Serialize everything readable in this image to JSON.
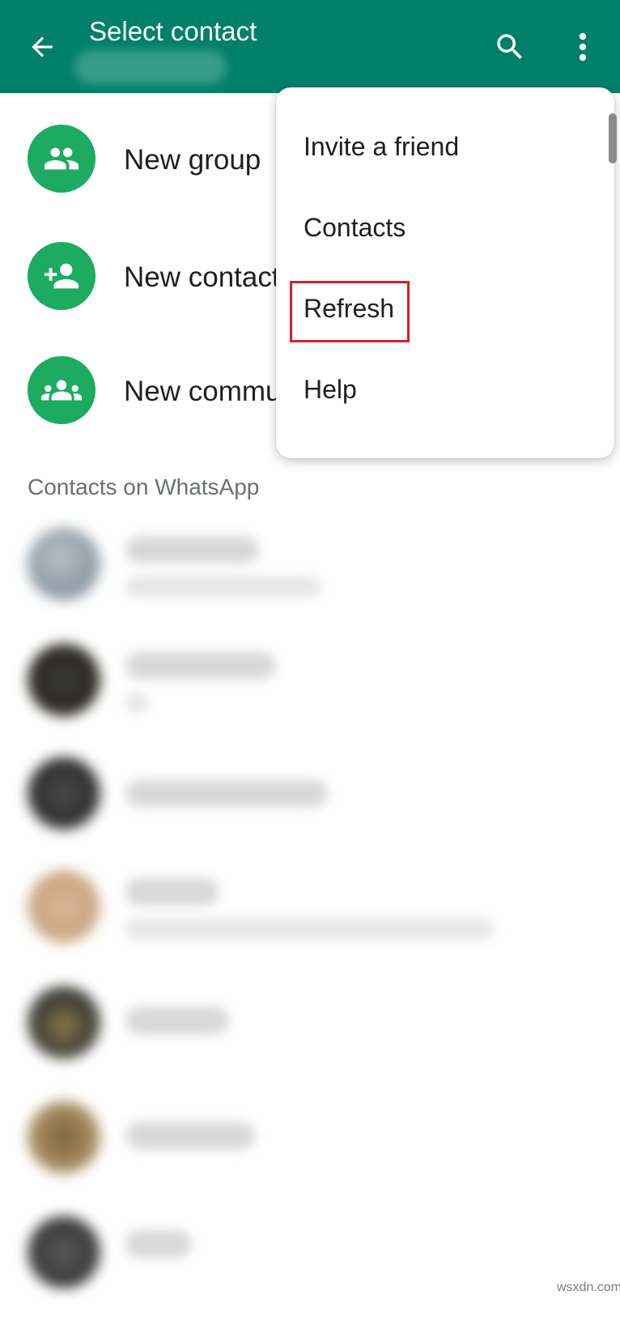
{
  "header": {
    "title": "Select contact",
    "back_icon": "arrow-back-icon",
    "search_icon": "search-icon",
    "more_icon": "more-vert-icon",
    "color": "#008069"
  },
  "actions": [
    {
      "label": "New group",
      "icon": "group-icon"
    },
    {
      "label": "New contact",
      "icon": "person-add-icon"
    },
    {
      "label": "New community",
      "icon": "community-icon"
    }
  ],
  "section_header": "Contacts on WhatsApp",
  "menu": {
    "items": [
      "Invite a friend",
      "Contacts",
      "Refresh",
      "Help"
    ],
    "highlighted": "Refresh",
    "highlight_color": "#d0212f"
  },
  "watermark": "wsxdn.com",
  "accent_color": "#1daa61"
}
